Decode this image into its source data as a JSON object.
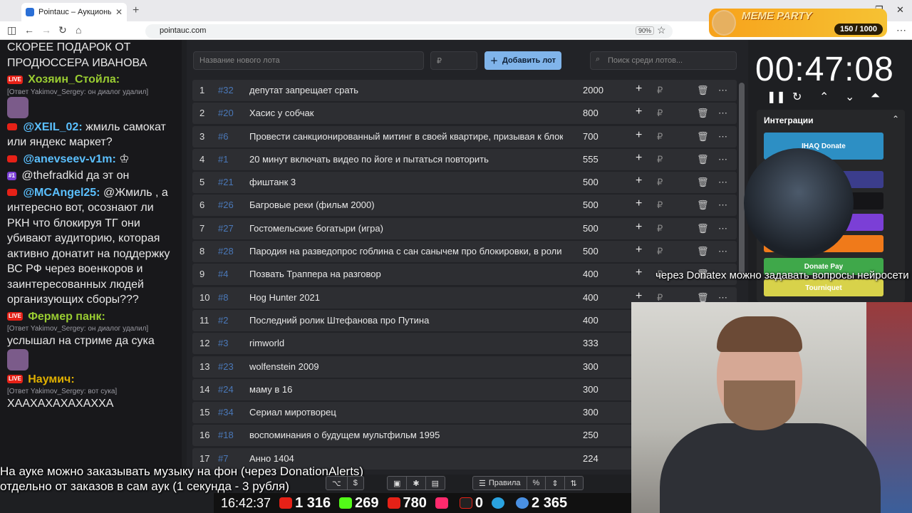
{
  "browser": {
    "tab_title": "Pointauc – Аукционы, лотереи",
    "url": "pointauc.com",
    "zoom": "90%"
  },
  "meme_party": {
    "name": "MEME PARTY",
    "counter": "150 / 1000"
  },
  "chat": [
    {
      "type": "text",
      "text": "СКОРЕЕ ПОДАРОК ОТ ПРОДЮССЕРА ИВАНОВА"
    },
    {
      "type": "msg",
      "user": "Хозяин_Стойла:",
      "color": "#9acd32",
      "reply": "[Ответ Yakimov_Sergey: он диалог удалил]",
      "text": ""
    },
    {
      "type": "msg",
      "user": "@XEIL_02:",
      "color": "#5bc0ff",
      "text": "жмиль самокат или яндекс маркет?"
    },
    {
      "type": "msg",
      "user": "@anevseev-v1m:",
      "color": "#5bc0ff",
      "text": ""
    },
    {
      "type": "msg",
      "user": "",
      "color": "#fff",
      "text": "@thefradkid да эт он"
    },
    {
      "type": "msg",
      "user": "@MCAngel25:",
      "color": "#5bc0ff",
      "text": "@Жмиль , а интересно вот, осознают ли РКН что блокируя ТГ они убивают аудиторию, которая активно донатит на поддержку ВС РФ через военкоров и заинтересованных людей организующих сборы???"
    },
    {
      "type": "msg",
      "user": "Фермер панк:",
      "color": "#9acd32",
      "reply": "[Ответ Yakimov_Sergey: он диалог удалил]",
      "text": "услышал на стриме да сука"
    },
    {
      "type": "msg",
      "user": "Наумич:",
      "color": "#e0b000",
      "reply": "[Ответ Yakimov_Sergey: вот сука]",
      "text": "ХААХАХАХАХАХХА"
    }
  ],
  "toolbar": {
    "new_lot_placeholder": "Название нового лота",
    "amount_placeholder": "₽",
    "add_label": "Добавить лот",
    "search_placeholder": "Поиск среди лотов..."
  },
  "lots": [
    {
      "n": "1",
      "id": "#32",
      "name": "депутат запрещает срать",
      "amount": "2000"
    },
    {
      "n": "2",
      "id": "#20",
      "name": "Хасис у собчак",
      "amount": "800"
    },
    {
      "n": "3",
      "id": "#6",
      "name": "Провести санкционированный митинг в своей квартире, призывая к блоки",
      "amount": "700"
    },
    {
      "n": "4",
      "id": "#1",
      "name": "20 минут включать видео по йоге и пытаться повторить",
      "amount": "555"
    },
    {
      "n": "5",
      "id": "#21",
      "name": "фиштанк 3",
      "amount": "500"
    },
    {
      "n": "6",
      "id": "#26",
      "name": "Багровые реки (фильм 2000)",
      "amount": "500"
    },
    {
      "n": "7",
      "id": "#27",
      "name": "Гостомельские богатыри (игра)",
      "amount": "500"
    },
    {
      "n": "8",
      "id": "#28",
      "name": "Пародия на разведопрос гоблина с сан санычем про блокировки, в роли с",
      "amount": "500"
    },
    {
      "n": "9",
      "id": "#4",
      "name": "Позвать Траппера на разговор",
      "amount": "400"
    },
    {
      "n": "10",
      "id": "#8",
      "name": "Hog Hunter 2021",
      "amount": "400"
    },
    {
      "n": "11",
      "id": "#2",
      "name": "Последний ролик Штефанова про Путина",
      "amount": "400"
    },
    {
      "n": "12",
      "id": "#3",
      "name": "rimworld",
      "amount": "333"
    },
    {
      "n": "13",
      "id": "#23",
      "name": "wolfenstein 2009",
      "amount": "300"
    },
    {
      "n": "14",
      "id": "#24",
      "name": "маму в 16",
      "amount": "300"
    },
    {
      "n": "15",
      "id": "#34",
      "name": "Сериал миротворец",
      "amount": "300"
    },
    {
      "n": "16",
      "id": "#18",
      "name": "воспоминания о будущем мультфильм 1995",
      "amount": "250"
    },
    {
      "n": "17",
      "id": "#7",
      "name": "Анно 1404",
      "amount": "224"
    }
  ],
  "timer": {
    "value": "00:47:08"
  },
  "integrations": {
    "header": "Интеграции",
    "buttons": [
      {
        "label": "IHAQ Donate",
        "color": "#2d8fc4"
      },
      {
        "label": "er",
        "color": "#3b3d8c"
      },
      {
        "label": "",
        "color": "#151518"
      },
      {
        "label": "",
        "color": "#7b3fd6"
      },
      {
        "label": "Alerts",
        "color": "#f07a1a"
      },
      {
        "label": "Donate Pay",
        "color": "#3fa84a"
      },
      {
        "label": "Tourniquet",
        "color": "#d8d24a"
      }
    ]
  },
  "overlay": {
    "donatex_text": "через Donatex можно задавать вопросы нейросети",
    "music_line1": "На ауке можно заказывать музыку на фон (через DonationAlerts)",
    "music_line2": "отдельно от заказов в сам аук (1 секунда - 3 рубля)"
  },
  "bottom": {
    "rules_label": "Правила"
  },
  "stats": {
    "clock": "16:42:37",
    "youtube": "1 316",
    "kick": "269",
    "vk": "780",
    "rutube": "0",
    "telegram": "",
    "viewers": "2 365"
  }
}
